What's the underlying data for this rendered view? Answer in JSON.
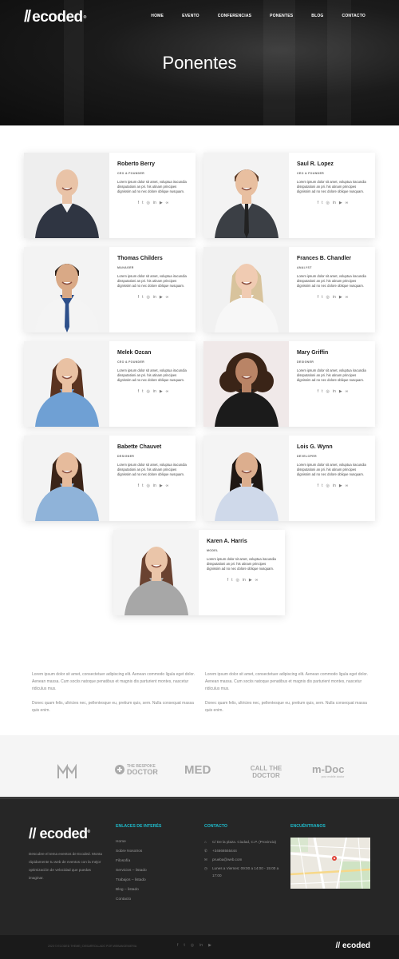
{
  "header": {
    "logo": "ecoded",
    "nav": [
      "HOME",
      "EVENTO",
      "CONFERENCIAS",
      "PONENTES",
      "BLOG",
      "CONTACTO"
    ],
    "title": "Ponentes"
  },
  "speakers": [
    {
      "name": "Roberto Berry",
      "role": "CEO & FOUNDER",
      "bio": "Lorem ipsum dolor sit amet, voluptua iracundia dissputationi an pri. his utinam principes dignissim ad no nec dolore oblique nusquam."
    },
    {
      "name": "Saul R. Lopez",
      "role": "CEO & FOUNDER",
      "bio": "Lorem ipsum dolor sit amet, voluptua iracundia dissputationi an pri. his utinam principes dignissim ad no nec dolore oblique nusquam."
    },
    {
      "name": "Thomas Childers",
      "role": "MANAGER",
      "bio": "Lorem ipsum dolor sit amet, voluptua iracundia dissputationi an pri. his utinam principes dignissim ad no nec dolore oblique nusquam."
    },
    {
      "name": "Frances B. Chandler",
      "role": "ANALYST",
      "bio": "Lorem ipsum dolor sit amet, voluptua iracundia dissputationi an pri. his utinam principes dignissim ad no nec dolore oblique nusquam."
    },
    {
      "name": "Melek Ozcan",
      "role": "CEO & FOUNDER",
      "bio": "Lorem ipsum dolor sit amet, voluptua iracundia dissputationi an pri. his utinam principes dignissim ad no nec dolore oblique nusquam."
    },
    {
      "name": "Mary Griffin",
      "role": "DESIGNER",
      "bio": "Lorem ipsum dolor sit amet, voluptua iracundia dissputationi an pri. his utinam principes dignissim ad no nec dolore oblique nusquam."
    },
    {
      "name": "Babette Chauvet",
      "role": "DESIGNER",
      "bio": "Lorem ipsum dolor sit amet, voluptua iracundia dissputationi an pri. his utinam principes dignissim ad no nec dolore oblique nusquam."
    },
    {
      "name": "Lois G. Wynn",
      "role": "DEVELOPER",
      "bio": "Lorem ipsum dolor sit amet, voluptua iracundia dissputationi an pri. his utinam principes dignissim ad no nec dolore oblique nusquam."
    },
    {
      "name": "Karen A. Harris",
      "role": "MODEL",
      "bio": "Lorem ipsum dolor sit amet, voluptua iracundia dissputationi an pri. his utinam principes dignissim ad no nec dolore oblique nusquam."
    }
  ],
  "social_icons": [
    "f",
    "t",
    "o",
    "in",
    "yt",
    "link"
  ],
  "text_section": {
    "left_p1": "Lorem ipsum dolor sit amet, consectetuer adipiscing elit. Aenean commodo ligula eget dolor. Aenean massa. Cum sociis natoque penatibus et magnis dis parturient montes, nascetur ridiculus mus.",
    "left_p2": "Donec quam felis, ultricies nec, pellentesque eu, pretium quis, sem. Nulla consequat massa quis enim.",
    "right_p1": "Lorem ipsum dolor sit amet, consectetuer adipiscing elit. Aenean commodo ligula eget dolor. Aenean massa. Cum sociis natoque penatibus et magnis dis parturient montes, nascetur ridiculus mus.",
    "right_p2": "Donec quam felis, ultricies nec, pellentesque eu, pretium quis, sem. Nulla consequat massa quis enim."
  },
  "partners": [
    "MED",
    "CALL THE DOCTOR",
    "m-Doc"
  ],
  "partner_extra": {
    "bespoke_the": "THE BESPOKE",
    "bespoke_doctor": "DOCTOR",
    "mdoc_tag": "your mobile doctor"
  },
  "footer": {
    "logo": "ecoded",
    "description": "Descubre el tema eventos de Ecoded. Monta rápidamente tu web de eventos con la mejor optimización de velocidad que puedas imaginar.",
    "links_heading": "ENLACES DE INTERÉS",
    "links": [
      "Home",
      "Sobre Nosotros",
      "Filosofía",
      "Servicios – listado",
      "Trabajos – listado",
      "Blog – listado",
      "Contacto"
    ],
    "contact_heading": "CONTACTO",
    "contact": [
      {
        "icon": "home-icon",
        "text": "C/ De la plaza. Ciudad, C.P. (Provincia)"
      },
      {
        "icon": "phone-icon",
        "text": "+34666555444"
      },
      {
        "icon": "mail-icon",
        "text": "prueba@web.com"
      },
      {
        "icon": "clock-icon",
        "text": "Lunes a Viernes: 09:00 a 14:00 - 15:00 a 17:00"
      }
    ],
    "map_heading": "ENCUÉNTRANOS",
    "copyright": "2023 © ECODED THEME | DESARROLLADO POR WEBANGENIERIA",
    "bottom_logo": "ecoded"
  }
}
